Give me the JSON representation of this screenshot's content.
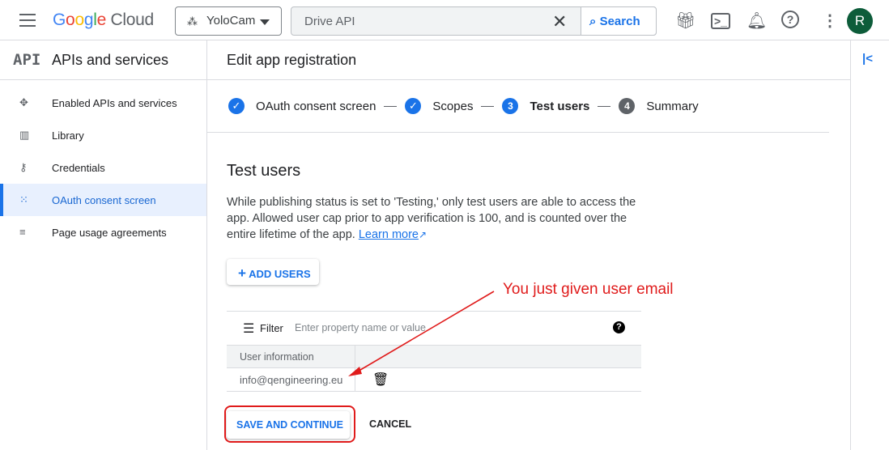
{
  "header": {
    "logo": "Google Cloud",
    "project": "YoloCam",
    "search_value": "Drive API",
    "search_button": "Search",
    "avatar": "R"
  },
  "sidebar": {
    "title": "APIs and services",
    "api_label": "API",
    "items": [
      {
        "label": "Enabled APIs and services",
        "icon": "diamond-arrows-icon"
      },
      {
        "label": "Library",
        "icon": "library-icon"
      },
      {
        "label": "Credentials",
        "icon": "key-icon"
      },
      {
        "label": "OAuth consent screen",
        "icon": "consent-icon",
        "active": true
      },
      {
        "label": "Page usage agreements",
        "icon": "settings-list-icon"
      }
    ]
  },
  "main": {
    "title": "Edit app registration",
    "steps": [
      {
        "label": "OAuth consent screen",
        "state": "done"
      },
      {
        "label": "Scopes",
        "state": "done"
      },
      {
        "label": "Test users",
        "num": "3",
        "state": "current"
      },
      {
        "label": "Summary",
        "num": "4",
        "state": "todo"
      }
    ],
    "section_title": "Test users",
    "description": "While publishing status is set to 'Testing,' only test users are able to access the app. Allowed user cap prior to app verification is 100, and is counted over the entire lifetime of the app.",
    "learn_more": "Learn more",
    "add_users": "ADD USERS",
    "filter_label": "Filter",
    "filter_placeholder": "Enter property name or value",
    "table_header": "User information",
    "users": [
      "info@qengineering.eu"
    ],
    "save": "SAVE AND CONTINUE",
    "cancel": "CANCEL"
  },
  "annotation": {
    "text": "You just given user email",
    "color": "#e01b1b"
  },
  "colors": {
    "accent": "#1a73e8"
  }
}
